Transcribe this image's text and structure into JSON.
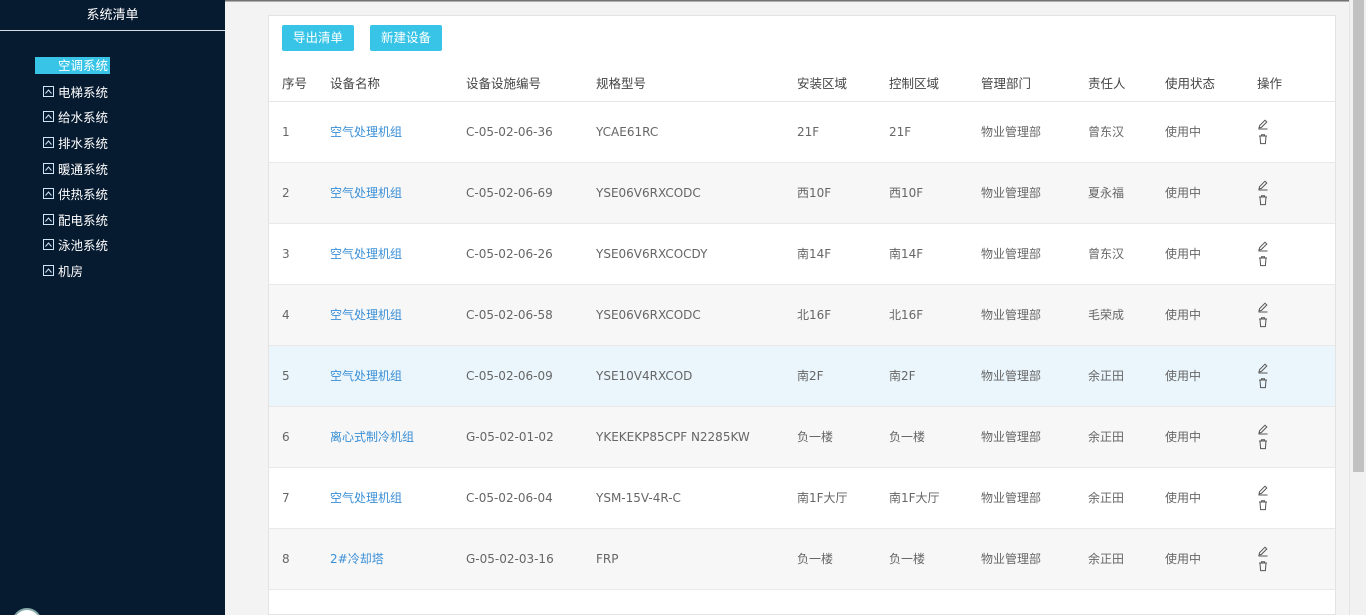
{
  "sidebar": {
    "title": "系统清单",
    "items": [
      {
        "label": "空调系统",
        "active": true
      },
      {
        "label": "电梯系统"
      },
      {
        "label": "给水系统"
      },
      {
        "label": "排水系统"
      },
      {
        "label": "暖通系统"
      },
      {
        "label": "供热系统"
      },
      {
        "label": "配电系统"
      },
      {
        "label": "泳池系统"
      },
      {
        "label": "机房"
      }
    ]
  },
  "toolbar": {
    "export_label": "导出清单",
    "new_label": "新建设备"
  },
  "table": {
    "headers": [
      "序号",
      "设备名称",
      "设备设施编号",
      "规格型号",
      "安装区域",
      "控制区域",
      "管理部门",
      "责任人",
      "使用状态",
      "操作"
    ],
    "rows": [
      [
        "1",
        "空气处理机组",
        "C-05-02-06-36",
        "YCAE61RC",
        "21F",
        "21F",
        "物业管理部",
        "曾东汉",
        "使用中"
      ],
      [
        "2",
        "空气处理机组",
        "C-05-02-06-69",
        "YSE06V6RXCODC",
        "西10F",
        "西10F",
        "物业管理部",
        "夏永福",
        "使用中"
      ],
      [
        "3",
        "空气处理机组",
        "C-05-02-06-26",
        "YSE06V6RXCOCDY",
        "南14F",
        "南14F",
        "物业管理部",
        "曾东汉",
        "使用中"
      ],
      [
        "4",
        "空气处理机组",
        "C-05-02-06-58",
        "YSE06V6RXCODC",
        "北16F",
        "北16F",
        "物业管理部",
        "毛荣成",
        "使用中"
      ],
      [
        "5",
        "空气处理机组",
        "C-05-02-06-09",
        "YSE10V4RXCOD",
        "南2F",
        "南2F",
        "物业管理部",
        "余正田",
        "使用中"
      ],
      [
        "6",
        "离心式制冷机组",
        "G-05-02-01-02",
        "YKEKEKP85CPF N2285KW",
        "负一楼",
        "负一楼",
        "物业管理部",
        "余正田",
        "使用中"
      ],
      [
        "7",
        "空气处理机组",
        "C-05-02-06-04",
        "YSM-15V-4R-C",
        "南1F大厅",
        "南1F大厅",
        "物业管理部",
        "余正田",
        "使用中"
      ],
      [
        "8",
        "2#冷却塔",
        "G-05-02-03-16",
        "FRP",
        "负一楼",
        "负一楼",
        "物业管理部",
        "余正田",
        "使用中"
      ]
    ],
    "highlighted_row": 5
  },
  "colors": {
    "sidebar_bg": "#061a30",
    "accent": "#37c4e6",
    "link": "#3a8fd6",
    "row_highlight": "#eaf6fc"
  },
  "icons": {
    "tree": "chevron-up-box-icon",
    "edit": "pencil-icon",
    "delete": "trash-icon"
  }
}
